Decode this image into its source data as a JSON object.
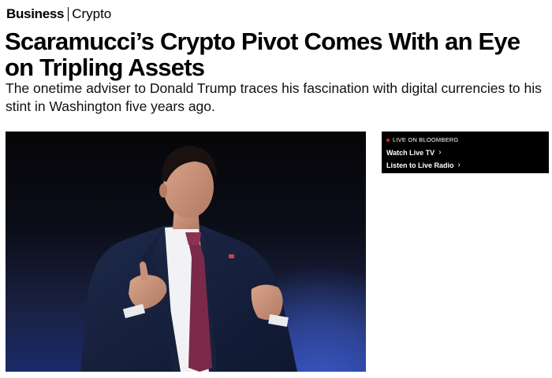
{
  "breadcrumb": {
    "section": "Business",
    "subsection": "Crypto"
  },
  "article": {
    "headline": "Scaramucci’s Crypto Pivot Comes With an Eye on Tripling Assets",
    "dek": "The onetime adviser to Donald Trump traces his fascination with digital currencies to his stint in Washington five years ago."
  },
  "live": {
    "label": "LIVE ON BLOOMBERG",
    "watch": "Watch Live TV",
    "listen": "Listen to Live Radio",
    "chevron": "›",
    "dot_color": "#e8232a"
  }
}
